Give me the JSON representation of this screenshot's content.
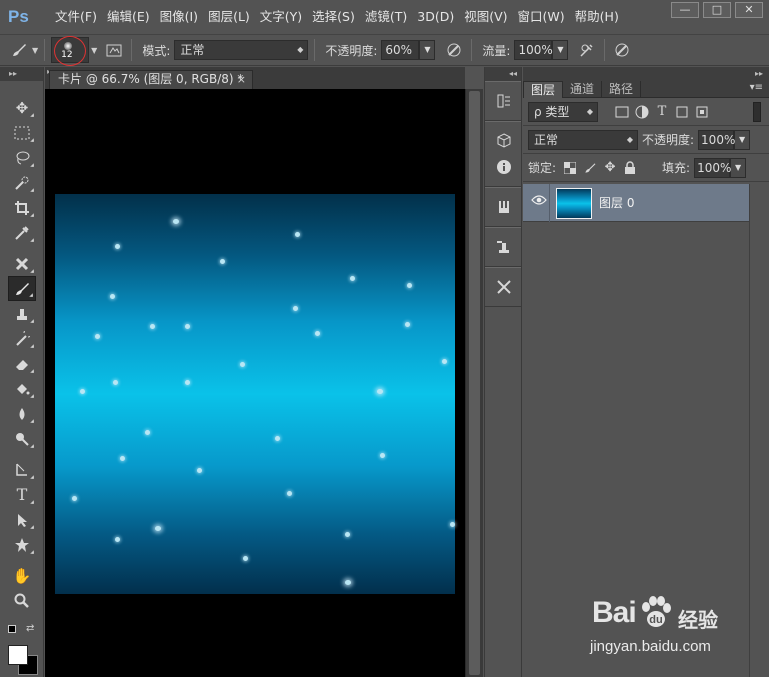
{
  "app": {
    "logo": "Ps"
  },
  "menu": [
    "文件(F)",
    "编辑(E)",
    "图像(I)",
    "图层(L)",
    "文字(Y)",
    "选择(S)",
    "滤镜(T)",
    "3D(D)",
    "视图(V)",
    "窗口(W)",
    "帮助(H)"
  ],
  "window_controls": {
    "minimize": "—",
    "maximize": "□",
    "close": "✕"
  },
  "options": {
    "brush_size": "12",
    "mode_label": "模式:",
    "mode_value": "正常",
    "opacity_label": "不透明度:",
    "opacity_value": "60%",
    "flow_label": "流量:",
    "flow_value": "100%"
  },
  "document": {
    "tab_title": "卡片 @ 66.7% (图层 0, RGB/8) *",
    "close": "×"
  },
  "layers_panel": {
    "tabs": [
      "图层",
      "通道",
      "路径"
    ],
    "filter_label": "ρ 类型",
    "blend_mode": "正常",
    "opacity_label": "不透明度:",
    "opacity_value": "100%",
    "lock_label": "锁定:",
    "fill_label": "填充:",
    "fill_value": "100%",
    "layer_name": "图层 0"
  },
  "watermark": {
    "logo_text": "Bai",
    "logo_suffix": "经验",
    "url": "jingyan.baidu.com"
  },
  "colors": {
    "accent": "#0ac2e9",
    "layer_selected": "#6e7a8a",
    "canvas_bg": "#000000"
  }
}
